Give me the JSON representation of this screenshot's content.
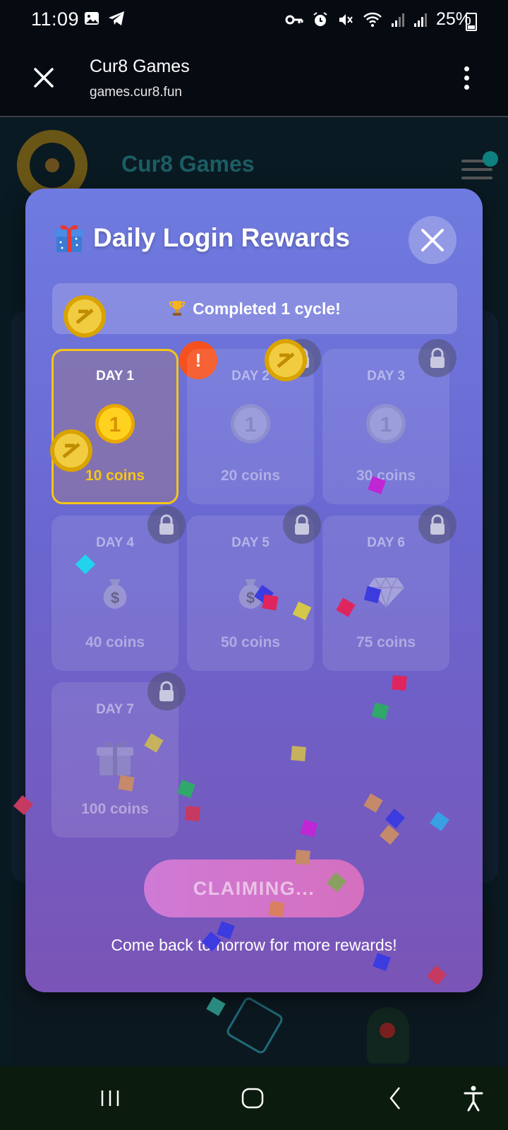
{
  "status_bar": {
    "time": "11:09",
    "battery": "25%",
    "icons": [
      "gallery-icon",
      "telegram-icon",
      "key-icon",
      "alarm-icon",
      "mute-icon",
      "wifi-icon",
      "signal-icon",
      "signal-icon"
    ]
  },
  "browser": {
    "title": "Cur8 Games",
    "url": "games.cur8.fun"
  },
  "site": {
    "title": "Cur8 Games"
  },
  "modal": {
    "title": "Daily Login Rewards",
    "title_icon": "gift-icon",
    "cycle_text": "Completed 1 cycle!",
    "cycle_icon": "trophy-icon",
    "alert_badge": "!",
    "days": [
      {
        "label": "DAY 1",
        "reward": "10 coins",
        "icon": "coin-icon",
        "state": "active"
      },
      {
        "label": "DAY 2",
        "reward": "20 coins",
        "icon": "coin-icon",
        "state": "locked"
      },
      {
        "label": "DAY 3",
        "reward": "30 coins",
        "icon": "coin-icon",
        "state": "locked"
      },
      {
        "label": "DAY 4",
        "reward": "40 coins",
        "icon": "money-bag-icon",
        "state": "locked"
      },
      {
        "label": "DAY 5",
        "reward": "50 coins",
        "icon": "money-bag-icon",
        "state": "locked"
      },
      {
        "label": "DAY 6",
        "reward": "75 coins",
        "icon": "diamond-icon",
        "state": "locked"
      },
      {
        "label": "DAY 7",
        "reward": "100 coins",
        "icon": "gift-icon",
        "state": "locked"
      }
    ],
    "claim_button": "CLAIMING...",
    "footer_text": "Come back tomorrow for more rewards!"
  },
  "colors": {
    "accent_gold": "#f5c518",
    "alert": "#f5511e",
    "modal_top": "#6f7be0",
    "modal_bottom": "#7a54b6"
  }
}
